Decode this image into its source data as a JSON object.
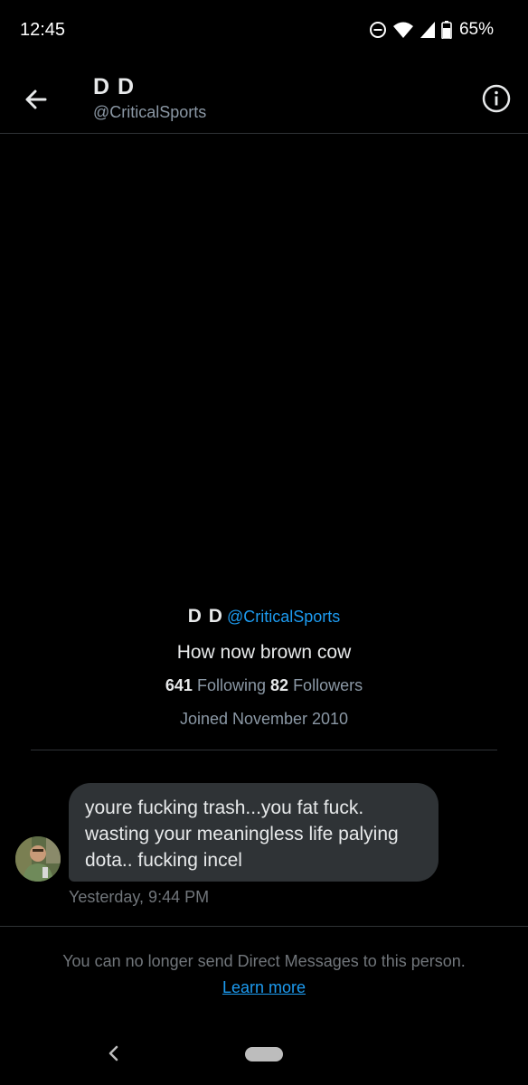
{
  "status_bar": {
    "time": "12:45",
    "battery": "65%",
    "icons": [
      "do-not-disturb-icon",
      "wifi-icon",
      "signal-icon",
      "battery-icon"
    ]
  },
  "header": {
    "name": "D D",
    "handle": "@CriticalSports"
  },
  "profile": {
    "name": "D D",
    "handle": "@CriticalSports",
    "bio": "How now brown cow",
    "following_count": "641",
    "following_label": "Following",
    "followers_count": "82",
    "followers_label": "Followers",
    "joined": "Joined November 2010"
  },
  "message": {
    "lines": [
      "youre fucking trash...you fat fuck.",
      "wasting your meaningless life palying",
      "dota.. fucking incel"
    ],
    "timestamp": "Yesterday, 9:44 PM"
  },
  "notice": {
    "text": "You can no longer send Direct Messages to this person.",
    "link": "Learn more"
  },
  "colors": {
    "background": "#000000",
    "accent": "#1d9bf0",
    "bubble": "#2f3336",
    "muted": "#71767b"
  }
}
